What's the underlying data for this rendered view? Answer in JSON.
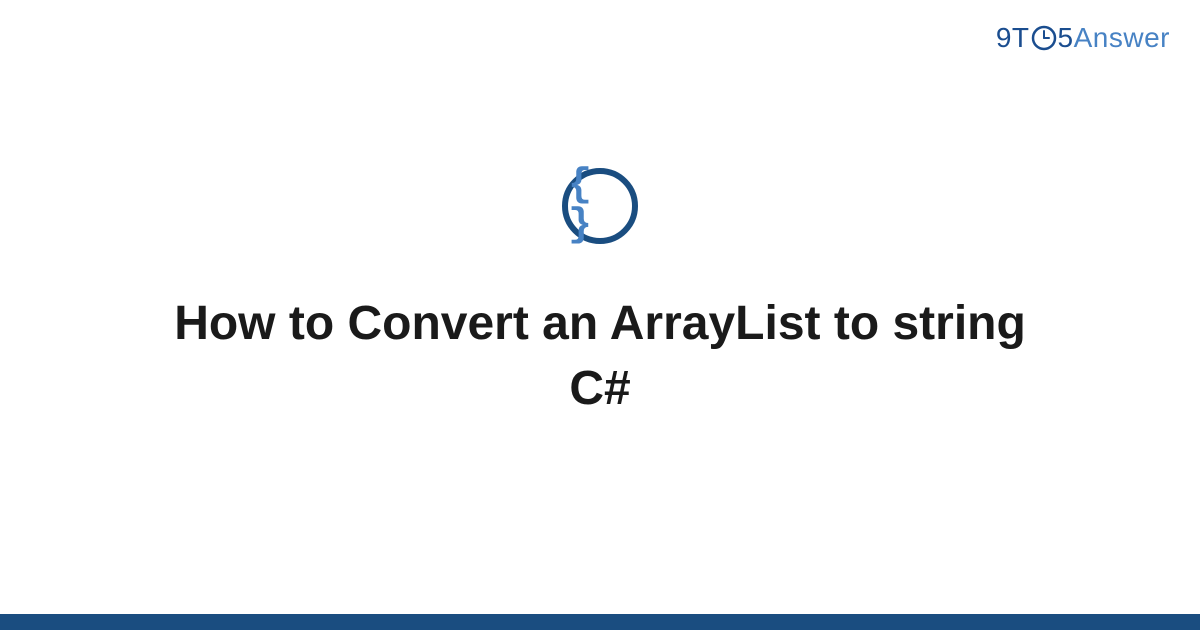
{
  "logo": {
    "part1": "9T",
    "part2": "5",
    "part3": "Answer"
  },
  "icon": {
    "name": "code-braces-icon",
    "glyph": "{ }"
  },
  "title": "How to Convert an ArrayList to string C#",
  "colors": {
    "brand_dark": "#1a4d80",
    "brand_light": "#4782c4",
    "text": "#1a1a1a"
  }
}
